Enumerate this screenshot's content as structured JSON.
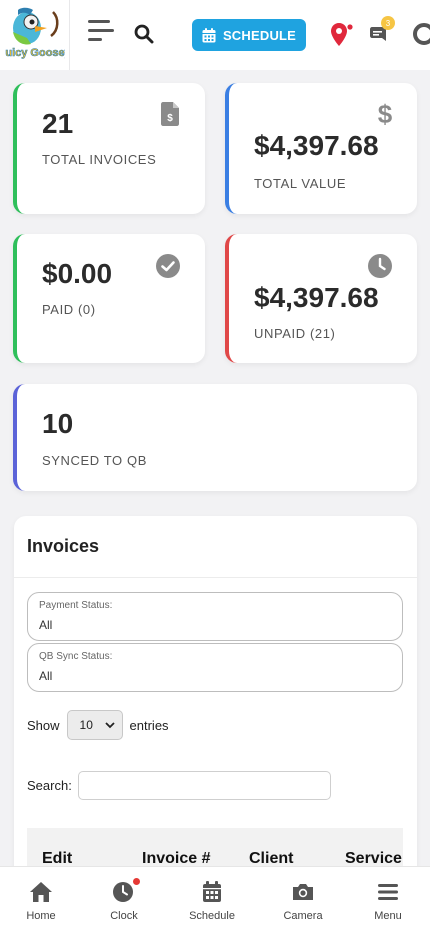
{
  "header": {
    "logo_text": "Juicy Goosey",
    "schedule_label": "SCHEDULE",
    "message_badge_count": "3"
  },
  "stats": {
    "total_invoices": {
      "value": "21",
      "label": "TOTAL INVOICES",
      "icon": "invoice-dollar-icon",
      "accent": "#2fbf5b"
    },
    "total_value": {
      "value": "$4,397.68",
      "label": "TOTAL VALUE",
      "icon": "dollar-icon",
      "accent": "#3b7fe3"
    },
    "paid": {
      "value": "$0.00",
      "label": "PAID (0)",
      "icon": "check-circle-icon",
      "accent": "#2fbf5b"
    },
    "unpaid": {
      "value": "$4,397.68",
      "label": "UNPAID (21)",
      "icon": "clock-icon",
      "accent": "#e04848"
    },
    "synced": {
      "value": "10",
      "label": "SYNCED TO QB",
      "accent": "#5b63d8"
    }
  },
  "invoices": {
    "title": "Invoices",
    "payment_status": {
      "label": "Payment Status:",
      "value": "All"
    },
    "qb_sync_status": {
      "label": "QB Sync Status:",
      "value": "All"
    },
    "show_label": "Show",
    "entries_value": "10",
    "entries_label": "entries",
    "search_label": "Search:",
    "columns": [
      "Edit",
      "Invoice #",
      "Client",
      "Service"
    ]
  },
  "bottom_nav": {
    "items": [
      {
        "label": "Home",
        "icon": "home-icon"
      },
      {
        "label": "Clock",
        "icon": "clock-icon"
      },
      {
        "label": "Schedule",
        "icon": "calendar-icon"
      },
      {
        "label": "Camera",
        "icon": "camera-icon"
      },
      {
        "label": "Menu",
        "icon": "menu-icon"
      }
    ]
  },
  "colors": {
    "primary": "#1fa3e0",
    "pin": "#e0283c",
    "badge": "#f6c544",
    "alert_dot": "#e53935"
  }
}
